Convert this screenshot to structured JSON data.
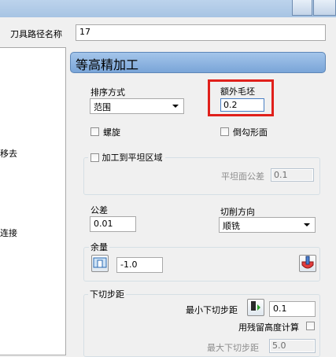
{
  "toolpath_name": {
    "label": "刀具路径名称",
    "value": "17"
  },
  "left_panel": {
    "items": [
      "移去",
      "连接"
    ]
  },
  "section": {
    "title": "等高精加工"
  },
  "ordering": {
    "label": "排序方式",
    "value": "范围"
  },
  "extra_stock": {
    "label": "额外毛坯",
    "value": "0.2"
  },
  "spiral": {
    "label": "螺旋"
  },
  "chamfer": {
    "label": "倒勾形面"
  },
  "flat_area": {
    "label": "加工到平坦区域",
    "tolerance_label": "平坦面公差",
    "tolerance_value": "0.1"
  },
  "tolerance": {
    "label": "公差",
    "value": "0.01"
  },
  "cut_direction": {
    "label": "切削方向",
    "value": "顺铣"
  },
  "allowance": {
    "label": "余量",
    "value": "-1.0"
  },
  "stepdown": {
    "group_label": "下切步距",
    "min_label": "最小下切步距",
    "min_value": "0.1",
    "scallop_label": "用残留高度计算",
    "max_label": "最大下切步距",
    "max_value": "5.0"
  }
}
